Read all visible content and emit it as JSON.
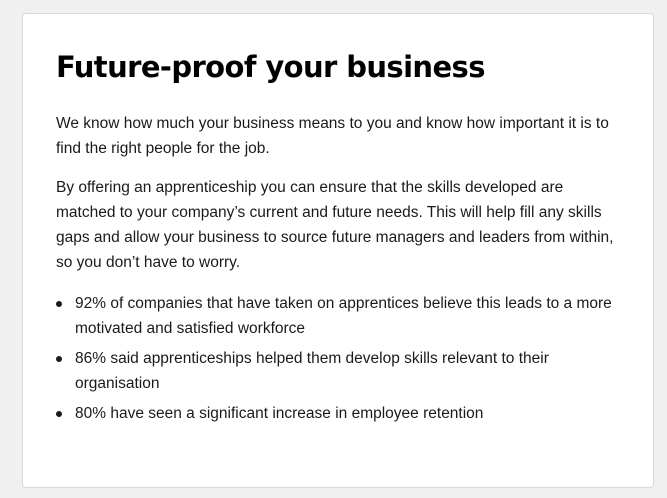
{
  "section": {
    "title": "Future-proof your business",
    "paragraphs": [
      "We know how much your business means to you and know how important it is to find the right people for the job.",
      "By offering an apprenticeship you can ensure that the skills developed are matched to your company’s current and future needs. This will help fill any skills gaps and allow your business to source future managers and leaders from within, so you don’t have to worry."
    ],
    "stats": [
      "92% of companies that have taken on apprentices believe this leads to a more motivated and satisfied workforce",
      "86% said apprenticeships helped them develop skills relevant to their organisation",
      "80% have seen a significant increase in employee retention"
    ]
  }
}
